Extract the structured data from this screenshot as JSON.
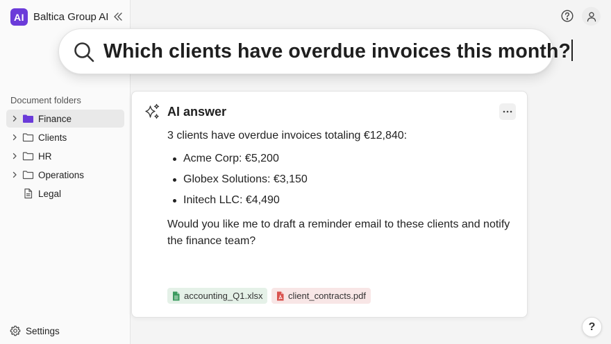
{
  "app": {
    "logo_text": "AI",
    "name": "Baltica Group AI",
    "brand_color": "#6b3bd9"
  },
  "sidebar": {
    "folders_title": "Document folders",
    "folders": [
      {
        "label": "Finance",
        "icon": "folder-filled-icon",
        "expandable": true,
        "active": true
      },
      {
        "label": "Clients",
        "icon": "folder-icon",
        "expandable": true,
        "active": false
      },
      {
        "label": "HR",
        "icon": "folder-icon",
        "expandable": true,
        "active": false
      },
      {
        "label": "Operations",
        "icon": "folder-icon",
        "expandable": true,
        "active": false
      },
      {
        "label": "Legal",
        "icon": "document-icon",
        "expandable": false,
        "active": false
      }
    ],
    "settings_label": "Settings"
  },
  "search": {
    "query": "Which clients have overdue invoices this month?"
  },
  "answer": {
    "title": "AI answer",
    "summary": "3 clients have overdue invoices totaling €12,840:",
    "items": [
      "Acme Corp: €5,200",
      "Globex Solutions: €3,150",
      "Initech LLC: €4,490"
    ],
    "followup": "Would you like me to draft a reminder email to these clients and notify the finance team?",
    "sources": [
      {
        "label": "accounting_Q1.xlsx",
        "type": "spreadsheet",
        "color": "#3c9a5f"
      },
      {
        "label": "client_contracts.pdf",
        "type": "pdf",
        "color": "#d9534f"
      }
    ]
  },
  "help_fab_label": "?"
}
